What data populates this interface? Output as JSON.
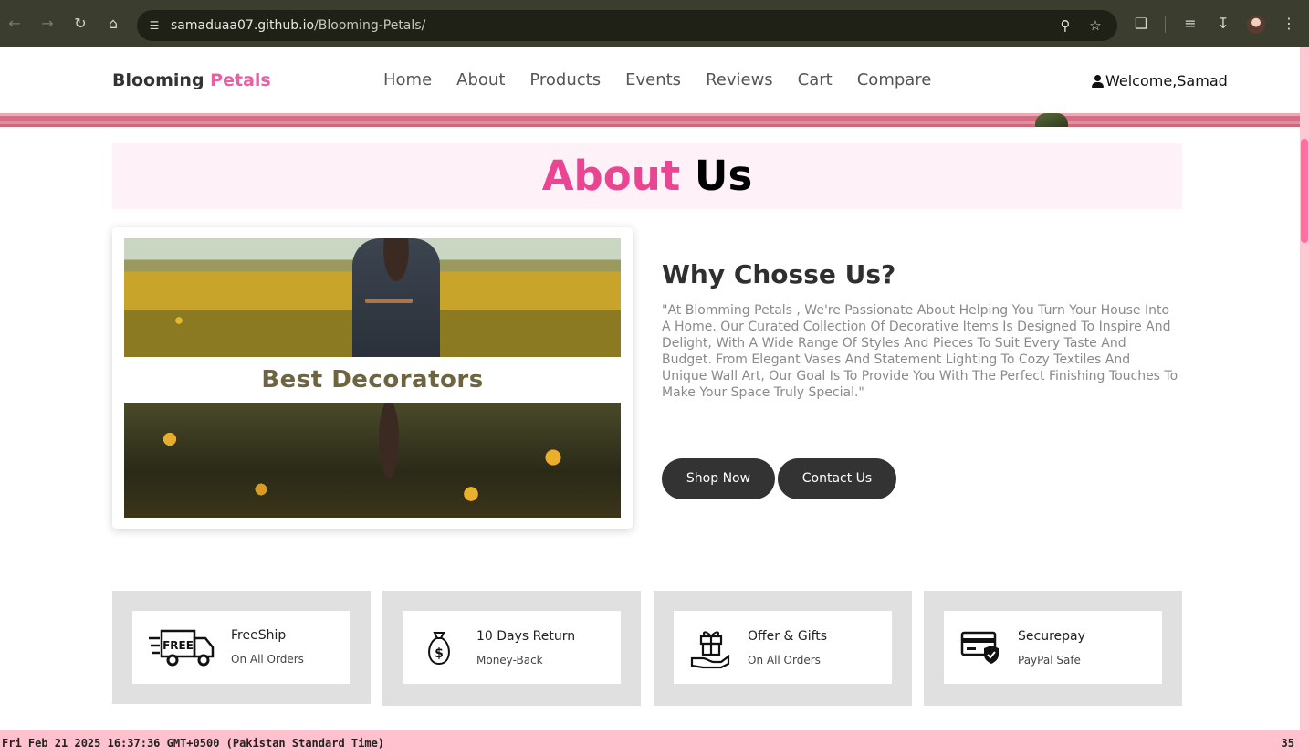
{
  "browser": {
    "url_host": "samaduaa07.github.io",
    "url_path": "/Blooming-Petals/"
  },
  "header": {
    "logo_primary": "Blooming",
    "logo_accent": "Petals",
    "nav": [
      "Home",
      "About",
      "Products",
      "Events",
      "Reviews",
      "Cart",
      "Compare"
    ],
    "welcome": "Welcome,Samad"
  },
  "about": {
    "title_accent": "About",
    "title_rest": "Us",
    "image_caption": "Best Decorators",
    "why_title": "Why Chosse Us?",
    "why_text": "\"At Blomming Petals , We're Passionate About Helping You Turn Your House Into A Home. Our Curated Collection Of Decorative Items Is Designed To Inspire And Delight, With A Wide Range Of Styles And Pieces To Suit Every Taste And Budget. From Elegant Vases And Statement Lighting To Cozy Textiles And Unique Wall Art, Our Goal Is To Provide You With The Perfect Finishing Touches To Make Your Space Truly Special.\"",
    "shop_button": "Shop Now",
    "contact_button": "Contact Us"
  },
  "features": [
    {
      "title": "FreeShip",
      "sub": "On All Orders",
      "icon": "free-shipping-truck-icon",
      "icon_text": "FREE"
    },
    {
      "title": "10 Days Return",
      "sub": "Money-Back",
      "icon": "money-bag-icon",
      "icon_text": "$"
    },
    {
      "title": "Offer & Gifts",
      "sub": "On All Orders",
      "icon": "gift-hand-icon"
    },
    {
      "title": "Securepay",
      "sub": "PayPal Safe",
      "icon": "secure-card-icon"
    }
  ],
  "status": {
    "datetime": "Fri Feb 21 2025 16:37:36 GMT+0500 (Pakistan Standard Time)",
    "count": "35"
  }
}
